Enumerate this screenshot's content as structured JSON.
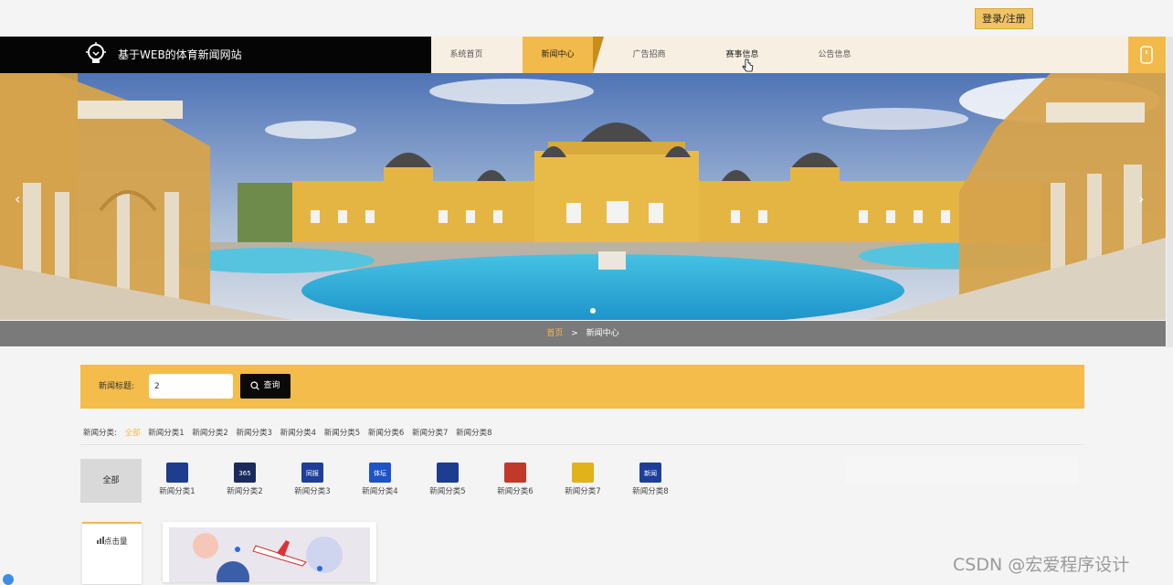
{
  "login_button": "登录/注册",
  "brand": {
    "title": "基于WEB的体育新闻网站",
    "icon": "lightbulb-logo-icon"
  },
  "nav": {
    "items": [
      {
        "label": "系统首页"
      },
      {
        "label": "新闻中心",
        "active": true
      },
      {
        "label": "广告招商"
      },
      {
        "label": "赛事信息"
      },
      {
        "label": "公告信息"
      }
    ],
    "side_icon": "phone-icon"
  },
  "banner": {
    "prev": "‹",
    "next": "›",
    "slide_count": 1
  },
  "breadcrumb": {
    "home": "首页",
    "separator": ">",
    "current": "新闻中心"
  },
  "search": {
    "label": "新闻标题:",
    "value": "2",
    "button": "查询"
  },
  "categories": {
    "label": "新闻分类:",
    "items": [
      "全部",
      "新闻分类1",
      "新闻分类2",
      "新闻分类3",
      "新闻分类4",
      "新闻分类5",
      "新闻分类6",
      "新闻分类7",
      "新闻分类8"
    ]
  },
  "category_tiles": {
    "all": "全部",
    "items": [
      {
        "label": "新闻分类1",
        "logo_text": "",
        "color": "#1e3d8f"
      },
      {
        "label": "新闻分类2",
        "logo_text": "365",
        "color": "#1b2a5c"
      },
      {
        "label": "新闻分类3",
        "logo_text": "同报",
        "color": "#1d3f9a"
      },
      {
        "label": "新闻分类4",
        "logo_text": "体坛",
        "color": "#1f53c8"
      },
      {
        "label": "新闻分类5",
        "logo_text": "",
        "color": "#1e3d8f"
      },
      {
        "label": "新闻分类6",
        "logo_text": "",
        "color": "#c0392b"
      },
      {
        "label": "新闻分类7",
        "logo_text": "",
        "color": "#e2b21b"
      },
      {
        "label": "新闻分类8",
        "logo_text": "新闻",
        "color": "#1d3f9a"
      }
    ]
  },
  "sort": {
    "label": "点击量",
    "icon": "bar-chart-icon"
  },
  "watermark": "CSDN @宏爱程序设计"
}
